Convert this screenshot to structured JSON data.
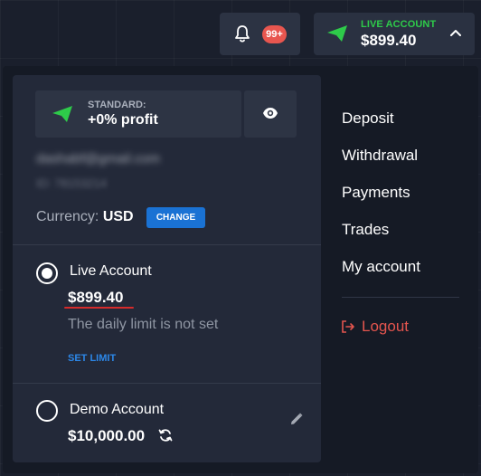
{
  "notifications": {
    "badge": "99+",
    "icon": "bell-icon"
  },
  "account_button": {
    "type_label": "LIVE ACCOUNT",
    "balance": "$899.40",
    "icon": "paper-plane-icon"
  },
  "plan": {
    "name": "STANDARD:",
    "profit": "+0% profit"
  },
  "profile": {
    "email": "dashabf@gmail.com",
    "id": "ID: 78153214",
    "currency_label": "Currency:",
    "currency_value": "USD",
    "change_label": "CHANGE"
  },
  "accounts": {
    "live": {
      "name": "Live Account",
      "balance": "$899.40",
      "limit_note": "The daily limit is not set",
      "set_limit_label": "SET LIMIT"
    },
    "demo": {
      "name": "Demo Account",
      "balance": "$10,000.00"
    }
  },
  "menu": {
    "items": [
      "Deposit",
      "Withdrawal",
      "Payments",
      "Trades",
      "My account"
    ],
    "logout": "Logout"
  },
  "colors": {
    "live_green": "#2ecb4a",
    "badge_red": "#e8564f",
    "accent_blue": "#1a72d4",
    "logout_red": "#e4554e"
  }
}
